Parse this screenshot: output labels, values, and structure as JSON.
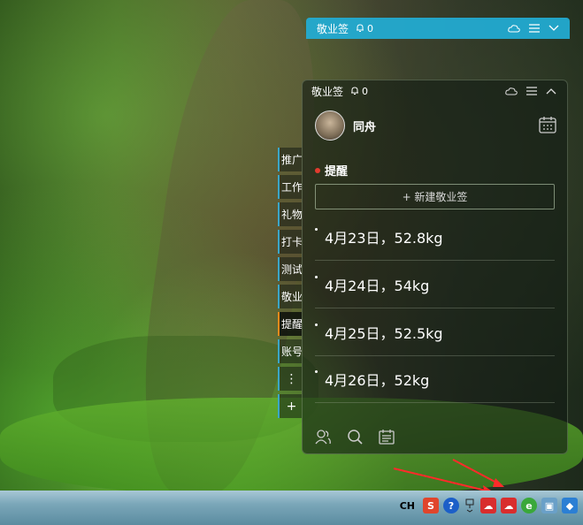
{
  "topbar": {
    "title": "敬业签",
    "count": "0"
  },
  "panel": {
    "title": "敬业签",
    "count": "0",
    "username": "同舟",
    "section_label": "提醒",
    "new_button": "+ 新建敬业签",
    "items": [
      {
        "text": "4月23日，52.8kg"
      },
      {
        "text": "4月24日，54kg"
      },
      {
        "text": "4月25日，52.5kg"
      },
      {
        "text": "4月26日，52kg"
      }
    ]
  },
  "tabs": [
    {
      "label": "推广"
    },
    {
      "label": "工作"
    },
    {
      "label": "礼物"
    },
    {
      "label": "打卡"
    },
    {
      "label": "测试"
    },
    {
      "label": "敬业"
    },
    {
      "label": "提醒"
    },
    {
      "label": "账号"
    },
    {
      "label": "⋮"
    },
    {
      "label": "+"
    }
  ],
  "taskbar": {
    "lang": "CH"
  },
  "colors": {
    "accent": "#22aed6",
    "active_tab": "#e98a1a",
    "alert": "#e23b2e"
  }
}
